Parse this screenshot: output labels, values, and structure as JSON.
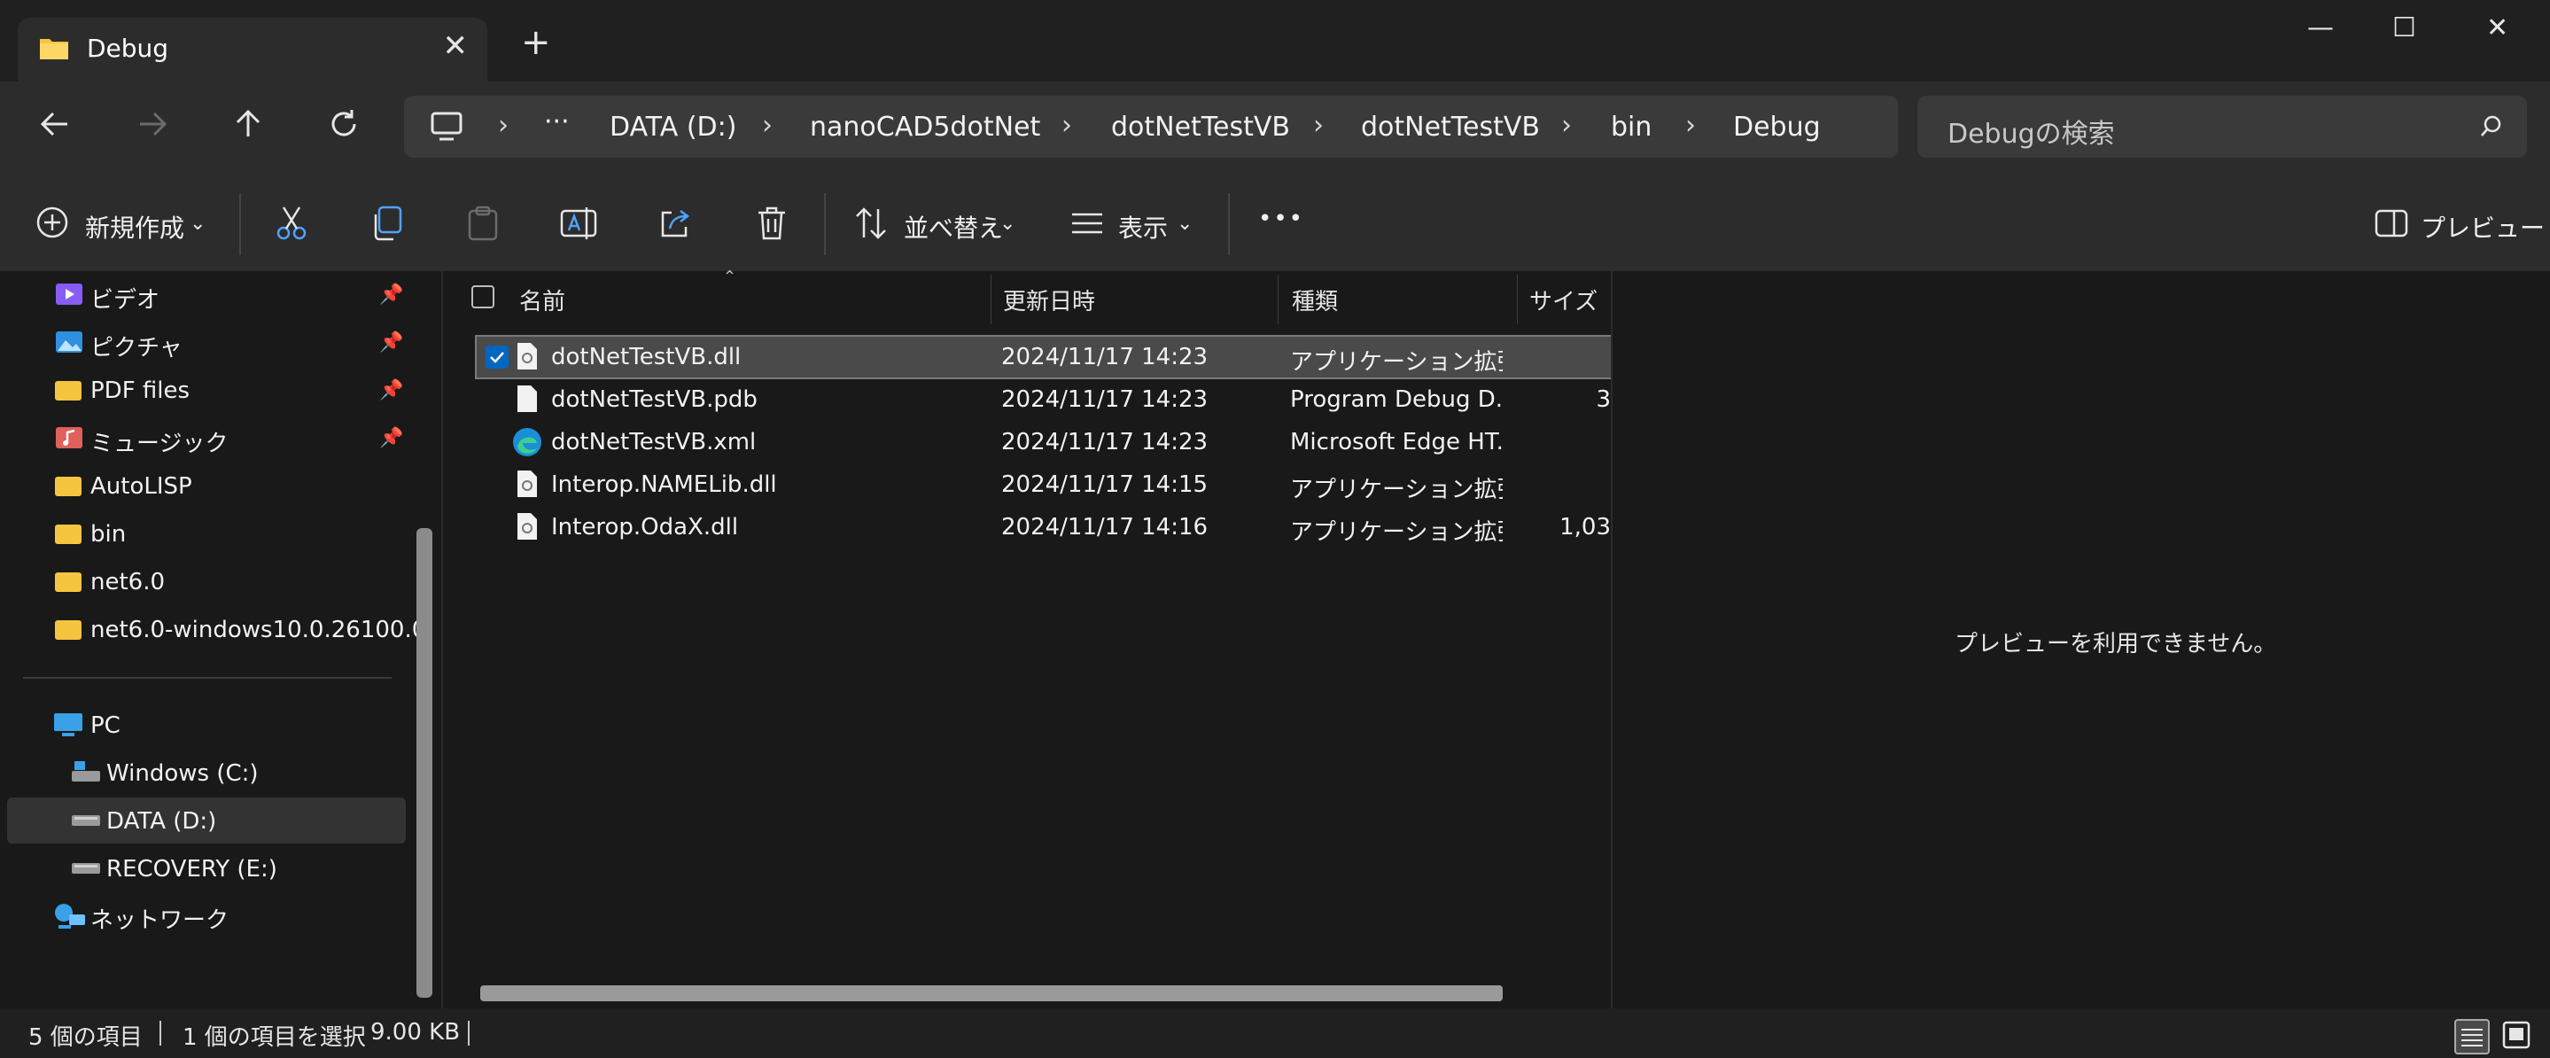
{
  "window": {
    "tab_title": "Debug",
    "new_tab": "+",
    "minimize": "—",
    "maximize": "☐",
    "close": "✕"
  },
  "address": {
    "breadcrumbs": [
      "DATA (D:)",
      "nanoCAD5dotNet",
      "dotNetTestVB",
      "dotNetTestVB",
      "bin",
      "Debug"
    ],
    "overflow": "···",
    "search_placeholder": "Debugの検索"
  },
  "toolbar": {
    "new_label": "新規作成",
    "sort_label": "並べ替え",
    "view_label": "表示",
    "more_label": "•••",
    "preview_label": "プレビュー"
  },
  "navpane": {
    "quick": [
      {
        "label": "ビデオ",
        "pinned": true,
        "icon": "video-icon"
      },
      {
        "label": "ピクチャ",
        "pinned": true,
        "icon": "pictures-icon"
      },
      {
        "label": "PDF files",
        "pinned": true,
        "icon": "folder-icon"
      },
      {
        "label": "ミュージック",
        "pinned": true,
        "icon": "music-icon"
      },
      {
        "label": "AutoLISP",
        "pinned": false,
        "icon": "folder-icon"
      },
      {
        "label": "bin",
        "pinned": false,
        "icon": "folder-icon"
      },
      {
        "label": "net6.0",
        "pinned": false,
        "icon": "folder-icon"
      },
      {
        "label": "net6.0-windows10.0.26100.0",
        "pinned": false,
        "icon": "folder-icon"
      }
    ],
    "pc": "PC",
    "drives": [
      "Windows (C:)",
      "DATA (D:)",
      "RECOVERY (E:)"
    ],
    "network": "ネットワーク",
    "selected_drive": "DATA (D:)"
  },
  "filelist": {
    "columns": [
      "名前",
      "更新日時",
      "種類",
      "サイズ"
    ],
    "rows": [
      {
        "name": "dotNetTestVB.dll",
        "modified": "2024/11/17 14:23",
        "type": "アプリケーション拡張",
        "size": "",
        "selected": true,
        "icon": "dll-file-icon"
      },
      {
        "name": "dotNetTestVB.pdb",
        "modified": "2024/11/17 14:23",
        "type": "Program Debug D...",
        "size": "3",
        "selected": false,
        "icon": "file-icon"
      },
      {
        "name": "dotNetTestVB.xml",
        "modified": "2024/11/17 14:23",
        "type": "Microsoft Edge HT...",
        "size": "",
        "selected": false,
        "icon": "edge-icon"
      },
      {
        "name": "Interop.NAMELib.dll",
        "modified": "2024/11/17 14:15",
        "type": "アプリケーション拡張",
        "size": "",
        "selected": false,
        "icon": "dll-file-icon"
      },
      {
        "name": "Interop.OdaX.dll",
        "modified": "2024/11/17 14:16",
        "type": "アプリケーション拡張",
        "size": "1,03",
        "selected": false,
        "icon": "dll-file-icon"
      }
    ]
  },
  "preview": {
    "message": "プレビューを利用できません。"
  },
  "status": {
    "count": "5 個の項目",
    "selection": "1 個の項目を選択",
    "size": "9.00 KB"
  },
  "colors": {
    "folder": "#f5c540",
    "accent": "#0067c0",
    "selection": "#4a4a4a"
  }
}
